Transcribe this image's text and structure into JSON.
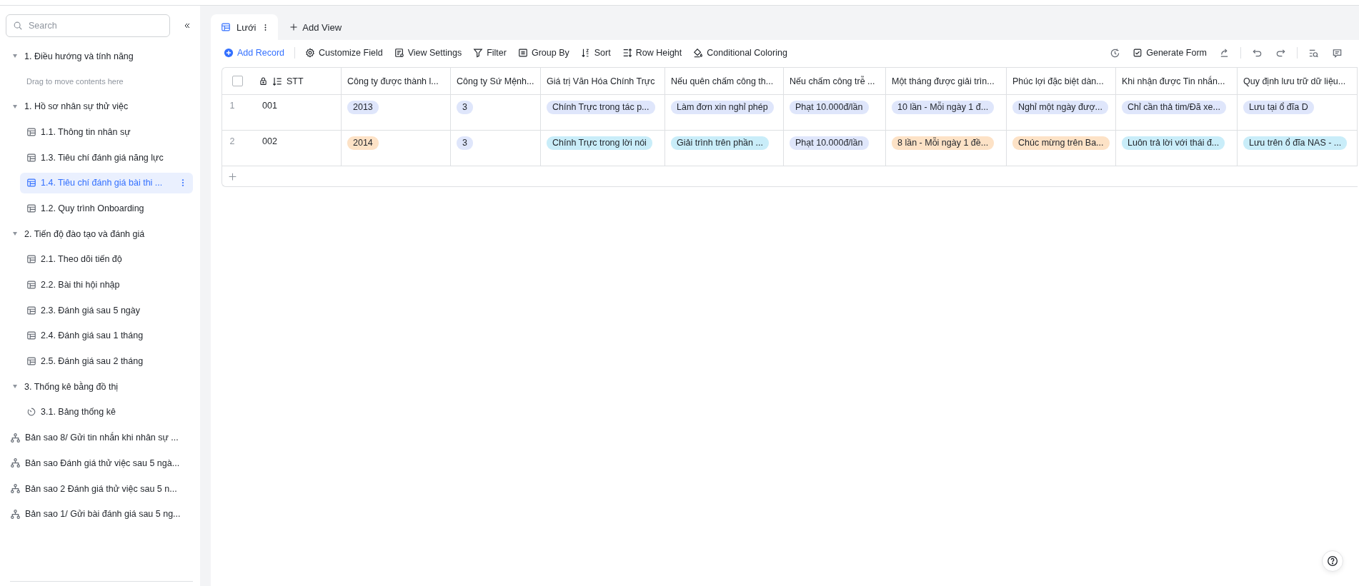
{
  "sidebar": {
    "search": {
      "placeholder": "Search"
    },
    "tree": [
      {
        "kind": "folder",
        "label": "1. Điều hướng và tính năng",
        "expanded": true,
        "selected": false,
        "hint": "Drag to move contents here"
      },
      {
        "kind": "folder",
        "label": "1. Hồ sơ nhân sự thử việc",
        "expanded": true,
        "selected": false,
        "children": [
          {
            "kind": "table",
            "label": "1.1. Thông tin nhân sự",
            "selected": false
          },
          {
            "kind": "table",
            "label": "1.3. Tiêu chí đánh giá năng lực",
            "selected": false
          },
          {
            "kind": "table",
            "label": "1.4. Tiêu chí đánh giá bài thi ...",
            "selected": true
          },
          {
            "kind": "table",
            "label": "1.2. Quy trình Onboarding",
            "selected": false
          }
        ]
      },
      {
        "kind": "folder",
        "label": "2. Tiến độ đào tạo và đánh giá",
        "expanded": true,
        "selected": false,
        "children": [
          {
            "kind": "table",
            "label": "2.1. Theo dõi tiến độ",
            "selected": false
          },
          {
            "kind": "table",
            "label": "2.2. Bài thi hội nhập",
            "selected": false
          },
          {
            "kind": "table",
            "label": "2.3. Đánh giá sau 5 ngày",
            "selected": false
          },
          {
            "kind": "table",
            "label": "2.4. Đánh giá sau 1 tháng",
            "selected": false
          },
          {
            "kind": "table",
            "label": "2.5. Đánh giá sau 2 tháng",
            "selected": false
          }
        ]
      },
      {
        "kind": "folder",
        "label": "3. Thống kê bằng đồ thị",
        "expanded": true,
        "selected": false,
        "children": [
          {
            "kind": "dashboard",
            "label": "3.1. Bảng thống kê",
            "selected": false
          }
        ]
      },
      {
        "kind": "workflow",
        "label": "Bản sao 8/ Gửi tin nhắn khi nhân sự ...",
        "selected": false
      },
      {
        "kind": "workflow",
        "label": "Bản sao Đánh giá thử việc sau 5 ngà...",
        "selected": false
      },
      {
        "kind": "workflow",
        "label": "Bản sao 2 Đánh giá thử việc sau 5 n...",
        "selected": false
      },
      {
        "kind": "workflow",
        "label": "Bản sao 1/ Gửi bài đánh giá sau 5 ng...",
        "selected": false
      }
    ]
  },
  "views": {
    "tabs": [
      {
        "label": "Lưới",
        "selected": true
      }
    ],
    "add_view": "Add View"
  },
  "toolbar": {
    "left": [
      {
        "kind": "add",
        "label": "Add Record"
      },
      {
        "kind": "customize",
        "label": "Customize Field"
      },
      {
        "kind": "settings",
        "label": "View Settings"
      },
      {
        "kind": "filter",
        "label": "Filter"
      },
      {
        "kind": "group",
        "label": "Group By"
      },
      {
        "kind": "sort",
        "label": "Sort"
      },
      {
        "kind": "height",
        "label": "Row Height"
      },
      {
        "kind": "color",
        "label": "Conditional Coloring"
      }
    ],
    "right": [
      {
        "kind": "history"
      },
      {
        "kind": "form",
        "label": "Generate Form"
      },
      {
        "kind": "share"
      },
      {
        "kind": "undo"
      },
      {
        "kind": "redo"
      },
      {
        "kind": "find"
      },
      {
        "kind": "comment"
      }
    ]
  },
  "table": {
    "select_all": {
      "checked": false
    },
    "columns": [
      {
        "label": "STT",
        "kind": "primary"
      },
      {
        "label": "Công ty được thành l...",
        "kind": "tags"
      },
      {
        "label": "Công ty Sứ Mệnh...",
        "kind": "tags"
      },
      {
        "label": "Giá trị Văn Hóa Chính Trực",
        "kind": "tags"
      },
      {
        "label": "Nếu quên chấm công th...",
        "kind": "tags"
      },
      {
        "label": "Nếu chấm công trễ ...",
        "kind": "tags"
      },
      {
        "label": "Một tháng được giải trìn...",
        "kind": "tags"
      },
      {
        "label": "Phúc lợi đặc biệt dàn...",
        "kind": "tags"
      },
      {
        "label": "Khi nhận được Tin nhắn...",
        "kind": "tags"
      },
      {
        "label": "Quy định lưu trữ dữ liệu...",
        "kind": "tags"
      }
    ],
    "rows": [
      {
        "number": "1",
        "cells": [
          {
            "text": "001"
          },
          {
            "text": "2013",
            "color": "#dfe6fb"
          },
          {
            "text": "3",
            "color": "#dfe6fb"
          },
          {
            "text": "Chính Trực trong tác p...",
            "color": "#dfe6fb"
          },
          {
            "text": "Làm đơn xin nghỉ phép",
            "color": "#dfe6fb"
          },
          {
            "text": "Phạt 10.000đ/lần",
            "color": "#dfe6fb"
          },
          {
            "text": "10 lần - Mỗi ngày 1 đ...",
            "color": "#dfe6fb"
          },
          {
            "text": "Nghỉ một ngày đượ...",
            "color": "#dfe6fb"
          },
          {
            "text": "Chỉ cần thả tim/Đã xe...",
            "color": "#dfe6fb"
          },
          {
            "text": "Lưu tại ổ đĩa D",
            "color": "#dfe6fb"
          }
        ]
      },
      {
        "number": "2",
        "cells": [
          {
            "text": "002"
          },
          {
            "text": "2014",
            "color": "#fde2c6"
          },
          {
            "text": "3",
            "color": "#dfe6fb"
          },
          {
            "text": "Chính Trực trong lời nói",
            "color": "#c9edf9"
          },
          {
            "text": "Giải trình trên phần ...",
            "color": "#c9edf9"
          },
          {
            "text": "Phạt 10.000đ/lần",
            "color": "#dfe6fb"
          },
          {
            "text": "8 lần - Mỗi ngày 1 đề...",
            "color": "#fde2c6"
          },
          {
            "text": "Chúc mừng trên Ba...",
            "color": "#fde2c6"
          },
          {
            "text": "Luôn trả lời với thái đ...",
            "color": "#c9edf9"
          },
          {
            "text": "Lưu trên ổ đĩa NAS - ...",
            "color": "#c9edf9"
          }
        ]
      }
    ]
  }
}
